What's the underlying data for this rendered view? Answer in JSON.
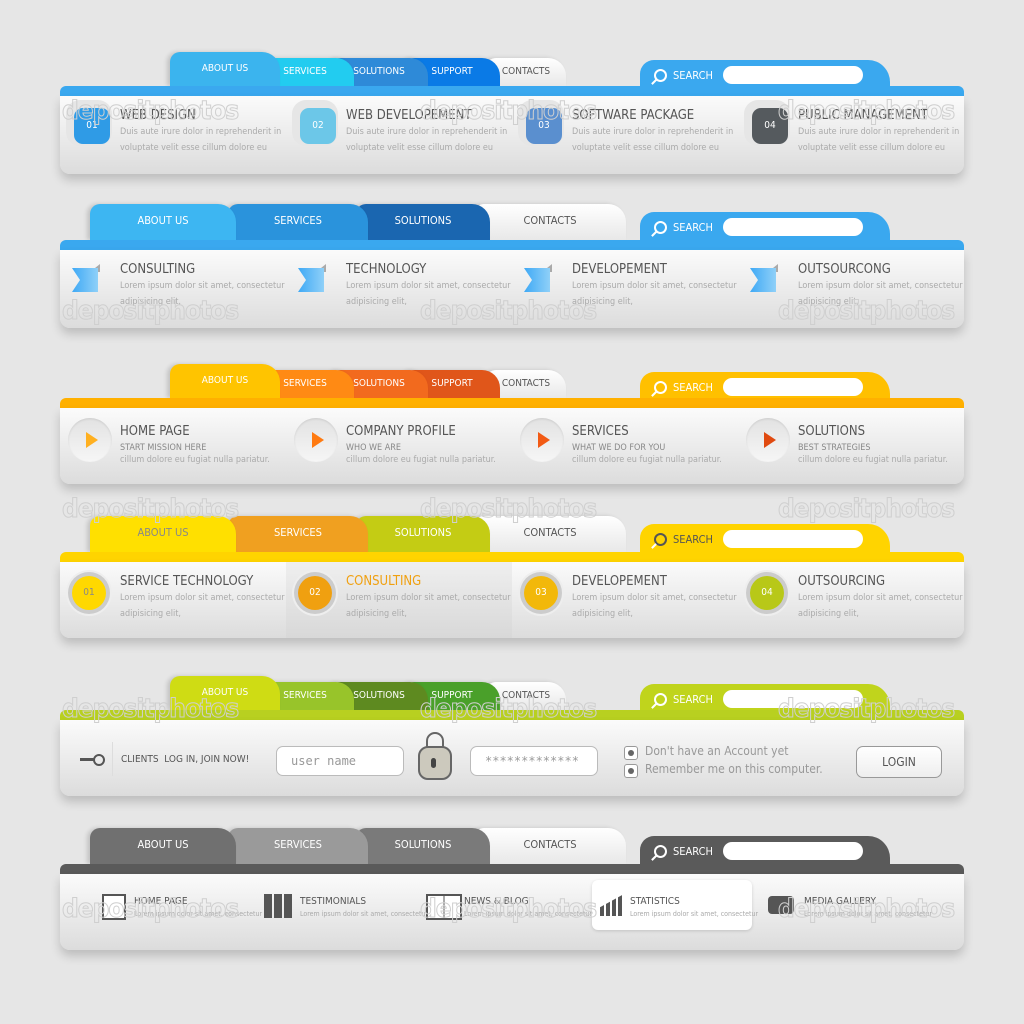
{
  "watermark": "depositphotos",
  "menu1": {
    "tabs": [
      {
        "label": "ABOUT US",
        "color": "#3bb4ee"
      },
      {
        "label": "SERVICES",
        "color": "#22ccf0"
      },
      {
        "label": "SOLUTIONS",
        "color": "#2e8ad8"
      },
      {
        "label": "SUPPORT",
        "color": "#0a7ae6"
      },
      {
        "label": "CONTACTS",
        "color": "#f4f4f4"
      }
    ],
    "accent": "#3aa8ef",
    "search_label": "SEARCH",
    "search_placeholder": "",
    "items": [
      {
        "num": "01",
        "title": "WEB DESIGN",
        "text1": "Duis aute irure dolor in reprehenderit in",
        "text2": "voluptate velit esse cillum dolore eu",
        "color": "#2f9be6"
      },
      {
        "num": "02",
        "title": "WEB DEVELOPEMENT",
        "text1": "Duis aute irure dolor in reprehenderit in",
        "text2": "voluptate velit esse cillum dolore eu",
        "color": "#6cc7e8"
      },
      {
        "num": "03",
        "title": "SOFTWARE PACKAGE",
        "text1": "Duis aute irure dolor in reprehenderit in",
        "text2": "voluptate velit esse cillum dolore eu",
        "color": "#5a8fcf"
      },
      {
        "num": "04",
        "title": "PUBLIC MANAGEMENT",
        "text1": "Duis aute irure dolor in reprehenderit in",
        "text2": "voluptate velit esse cillum dolore eu",
        "color": "#555a5e"
      }
    ]
  },
  "menu2": {
    "tabs": [
      {
        "label": "ABOUT US",
        "color": "#3db6f2"
      },
      {
        "label": "SERVICES",
        "color": "#2a93dc"
      },
      {
        "label": "SOLUTIONS",
        "color": "#1a66b0"
      },
      {
        "label": "CONTACTS",
        "color": "#f4f4f4"
      }
    ],
    "accent": "#3aa8ef",
    "search_label": "SEARCH",
    "items": [
      {
        "title": "CONSULTING",
        "text1": "Lorem ipsum dolor sit amet, consectetur",
        "text2": "adipisicing elit,"
      },
      {
        "title": "TECHNOLOGY",
        "text1": "Lorem ipsum dolor sit amet, consectetur",
        "text2": "adipisicing elit,"
      },
      {
        "title": "DEVELOPEMENT",
        "text1": "Lorem ipsum dolor sit amet, consectetur",
        "text2": "adipisicing elit,"
      },
      {
        "title": "OUTSOURCONG",
        "text1": "Lorem ipsum dolor sit amet, consectetur",
        "text2": "adipisicing elit,"
      }
    ]
  },
  "menu3": {
    "tabs": [
      {
        "label": "ABOUT US",
        "color": "#ffc400"
      },
      {
        "label": "SERVICES",
        "color": "#ff8a14"
      },
      {
        "label": "SOLUTIONS",
        "color": "#f26a1e"
      },
      {
        "label": "SUPPORT",
        "color": "#e0561a"
      },
      {
        "label": "CONTACTS",
        "color": "#f4f4f4"
      }
    ],
    "accent": "#ffb000",
    "search_label": "SEARCH",
    "items": [
      {
        "title": "HOME PAGE",
        "subtitle": "START MISSION HERE",
        "text": "cillum dolore eu fugiat nulla pariatur.",
        "color": "#ffb020"
      },
      {
        "title": "COMPANY PROFILE",
        "subtitle": "WHO WE ARE",
        "text": "cillum dolore eu fugiat nulla pariatur.",
        "color": "#ff7a10"
      },
      {
        "title": "SERVICES",
        "subtitle": "WHAT WE DO FOR YOU",
        "text": "cillum dolore eu fugiat nulla pariatur.",
        "color": "#f25a14"
      },
      {
        "title": "SOLUTIONS",
        "subtitle": "BEST STRATEGIES",
        "text": "cillum dolore eu fugiat nulla pariatur.",
        "color": "#e04a10"
      }
    ]
  },
  "menu4": {
    "tabs": [
      {
        "label": "ABOUT US",
        "color": "#ffe000"
      },
      {
        "label": "SERVICES",
        "color": "#f0a020"
      },
      {
        "label": "SOLUTIONS",
        "color": "#c4cc14"
      },
      {
        "label": "CONTACTS",
        "color": "#f4f4f4"
      }
    ],
    "accent": "#ffd400",
    "search_label": "SEARCH",
    "items": [
      {
        "num": "01",
        "title": "SERVICE TECHNOLOGY",
        "text1": "Lorem ipsum dolor sit amet, consectetur",
        "text2": "adipisicing elit,",
        "color": "#ffd800",
        "active": false
      },
      {
        "num": "02",
        "title": "CONSULTING",
        "text1": "Lorem ipsum dolor sit amet, consectetur",
        "text2": "adipisicing elit,",
        "color": "#f0a010",
        "active": true
      },
      {
        "num": "03",
        "title": "DEVELOPEMENT",
        "text1": "Lorem ipsum dolor sit amet, consectetur",
        "text2": "adipisicing elit,",
        "color": "#f2b80a",
        "active": false
      },
      {
        "num": "04",
        "title": "OUTSOURCING",
        "text1": "Lorem ipsum dolor sit amet, consectetur",
        "text2": "adipisicing elit,",
        "color": "#b8c818",
        "active": false
      }
    ]
  },
  "menu5": {
    "tabs": [
      {
        "label": "ABOUT US",
        "color": "#cfdc14"
      },
      {
        "label": "SERVICES",
        "color": "#98c42a"
      },
      {
        "label": "SOLUTIONS",
        "color": "#5e8a20"
      },
      {
        "label": "SUPPORT",
        "color": "#4aa02a"
      },
      {
        "label": "CONTACTS",
        "color": "#f4f4f4"
      }
    ],
    "accent": "#b8d020",
    "search_label": "SEARCH",
    "login": {
      "clients_label": "CLIENTS  LOG IN, JOIN NOW!",
      "username_placeholder": "user name",
      "password_value": "*************",
      "option1": "Don't have an Account yet",
      "option2": "Remember me on this computer.",
      "login_button": "LOGIN"
    }
  },
  "menu6": {
    "tabs": [
      {
        "label": "ABOUT US",
        "color": "#707070"
      },
      {
        "label": "SERVICES",
        "color": "#9a9a9a"
      },
      {
        "label": "SOLUTIONS",
        "color": "#7a7a7a"
      },
      {
        "label": "CONTACTS",
        "color": "#f4f4f4"
      }
    ],
    "accent": "#5a5a5a",
    "search_label": "SEARCH",
    "items": [
      {
        "title": "HOME PAGE",
        "text": "Lorem ipsum dolor sit amet, consectetur",
        "icon": "door-icon"
      },
      {
        "title": "TESTIMONIALS",
        "text": "Lorem ipsum dolor sit amet, consectetur",
        "icon": "binders-icon"
      },
      {
        "title": "NEWS & BLOG",
        "text": "Lorem ipsum dolor sit amet, consectetur",
        "icon": "book-icon"
      },
      {
        "title": "STATISTICS",
        "text": "Lorem ipsum dolor sit amet, consectetur",
        "icon": "chart-icon",
        "active": true
      },
      {
        "title": "MEDIA GALLERY",
        "text": "Lorem ipsum dolor sit amet, consectetur",
        "icon": "camera-icon"
      }
    ]
  }
}
